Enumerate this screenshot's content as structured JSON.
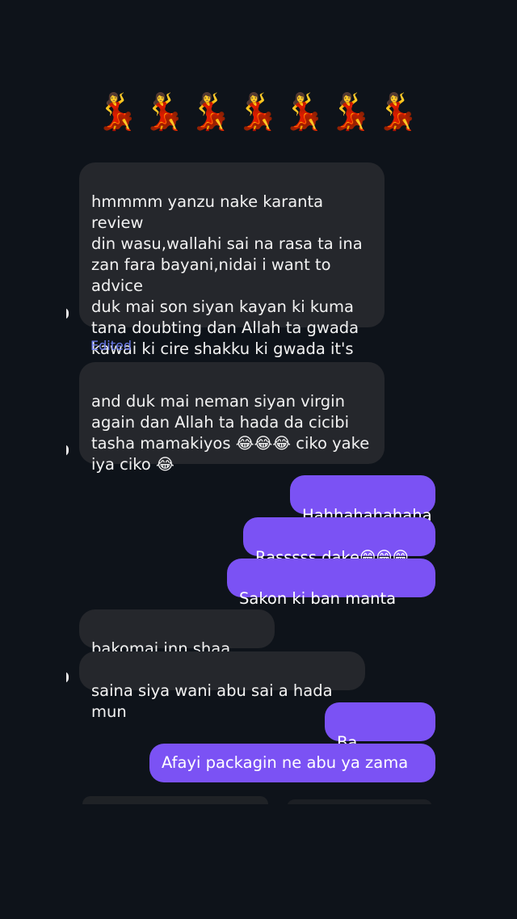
{
  "header": {
    "emoji_row": "💃💃💃💃💃💃💃"
  },
  "messages": {
    "m1": "hmmmm yanzu nake karanta review\ndin wasu,wallahi sai na rasa ta ina\nzan fara bayani,nidai i want to advice\nduk mai son siyan kayan ki kuma\ntana doubting dan Allah ta gwada\nkawai ki cire shakku ki gwada it's\nworth every penny",
    "edited_label": "Edited",
    "m2": "and duk mai neman siyan virgin\nagain dan Allah ta hada da cicibi\ntasha mamakiyos 😂😂😂 ciko yake\niya ciko 😂",
    "m3": "Hahhahahahaha",
    "m4": "Rasssss dake😁😁😁",
    "m5": "Sakon ki ban manta bafa",
    "m6": "bakomai inn shaa Allah",
    "m7": "saina siya wani abu sai a hada mun",
    "m8": "Ba damuwa",
    "m9": "Afayi packagin ne abu ya zama"
  },
  "controls": {
    "scroll_down_icon": "↓"
  },
  "colors": {
    "background": "#0e131a",
    "incoming_bubble": "#25272c",
    "outgoing_bubble": "#7b52f4",
    "edited_label": "#6b7ae8"
  }
}
